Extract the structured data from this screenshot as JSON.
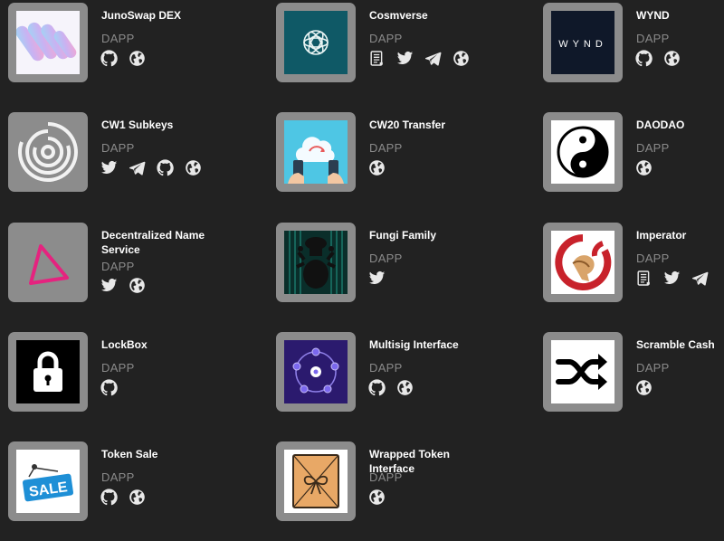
{
  "apps": [
    {
      "name": "JunoSwap DEX",
      "type": "DAPP",
      "logo": "junoswap-logo",
      "links": [
        "github-icon",
        "globe-icon"
      ]
    },
    {
      "name": "Cosmverse",
      "type": "DAPP",
      "logo": "cosmverse-logo",
      "links": [
        "document-icon",
        "twitter-icon",
        "telegram-icon",
        "globe-icon"
      ]
    },
    {
      "name": "WYND",
      "type": "DAPP",
      "logo": "wynd-logo",
      "logo_text": "WYND",
      "links": [
        "github-icon",
        "globe-icon"
      ]
    },
    {
      "name": "CW1 Subkeys",
      "type": "DAPP",
      "logo": "cw1-subkeys-logo",
      "links": [
        "twitter-icon",
        "telegram-icon",
        "github-icon",
        "globe-icon"
      ]
    },
    {
      "name": "CW20 Transfer",
      "type": "DAPP",
      "logo": "cw20-transfer-logo",
      "links": [
        "globe-icon"
      ]
    },
    {
      "name": "DAODAO",
      "type": "DAPP",
      "logo": "daodao-logo",
      "links": [
        "globe-icon"
      ]
    },
    {
      "name": "Decentralized Name Service",
      "type": "DAPP",
      "logo": "dns-logo",
      "links": [
        "twitter-icon",
        "globe-icon"
      ]
    },
    {
      "name": "Fungi Family",
      "type": "DAPP",
      "logo": "fungi-family-logo",
      "links": [
        "twitter-icon"
      ]
    },
    {
      "name": "Imperator",
      "type": "DAPP",
      "logo": "imperator-logo",
      "links": [
        "document-icon",
        "twitter-icon",
        "telegram-icon"
      ]
    },
    {
      "name": "LockBox",
      "type": "DAPP",
      "logo": "lockbox-logo",
      "links": [
        "github-icon"
      ]
    },
    {
      "name": "Multisig Interface",
      "type": "DAPP",
      "logo": "multisig-logo",
      "links": [
        "github-icon",
        "globe-icon"
      ]
    },
    {
      "name": "Scramble Cash",
      "type": "DAPP",
      "logo": "scramble-cash-logo",
      "links": [
        "globe-icon"
      ]
    },
    {
      "name": "Token Sale",
      "type": "DAPP",
      "logo": "token-sale-logo",
      "logo_text": "SALE",
      "links": [
        "github-icon",
        "globe-icon"
      ]
    },
    {
      "name": "Wrapped Token Interface",
      "type": "DAPP",
      "logo": "wrapped-token-logo",
      "links": [
        "globe-icon"
      ]
    }
  ]
}
